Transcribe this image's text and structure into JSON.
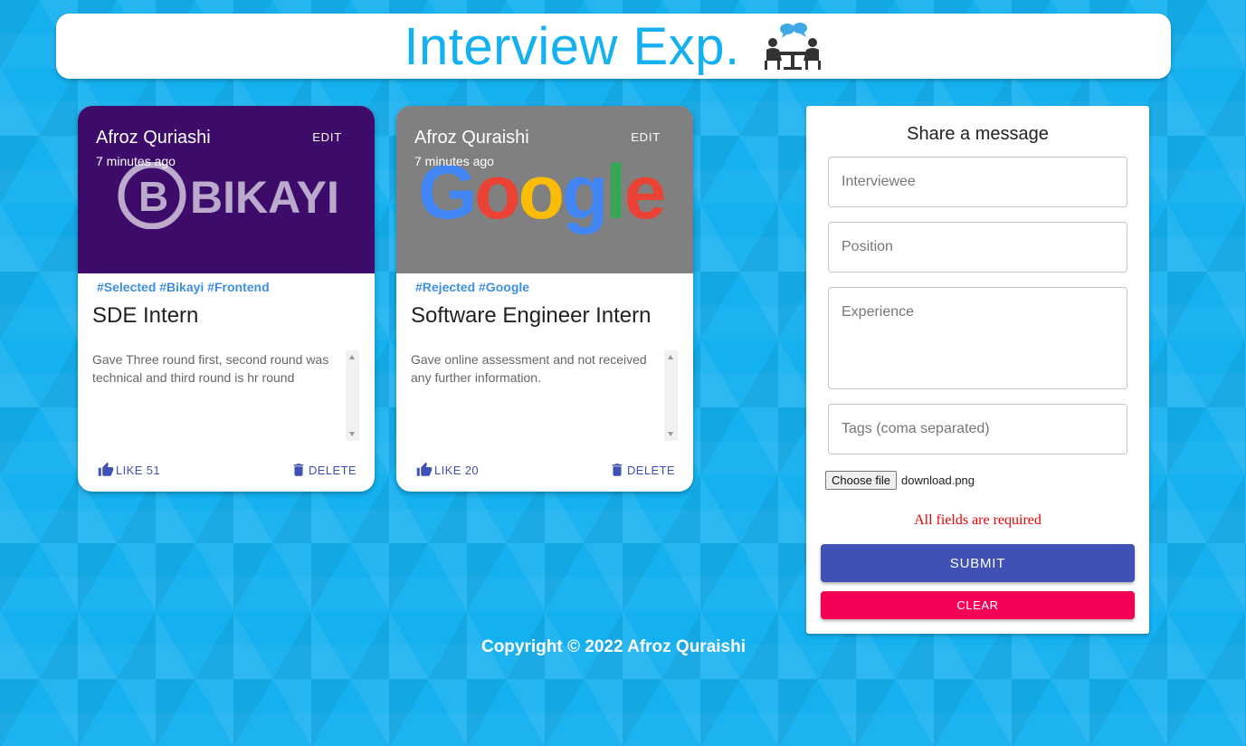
{
  "header": {
    "title": "Interview Exp."
  },
  "posts": [
    {
      "author": "Afroz Quriashi",
      "time": "7 minutes ago",
      "edit_label": "EDIT",
      "media_brand": "BIKAYI",
      "media_color": "#3d0c6b",
      "tags": "#Selected #Bikayi #Frontend",
      "title": "SDE Intern",
      "message": "Gave Three round first, second round was technical and third round is hr round",
      "like_label": "LIKE 51",
      "delete_label": "DELETE"
    },
    {
      "author": "Afroz Quraishi",
      "time": "7 minutes ago",
      "edit_label": "EDIT",
      "media_brand": "Google",
      "media_color": "#808080",
      "tags": "#Rejected #Google",
      "title": "Software Engineer Intern",
      "message": "Gave online assessment and not received any further information.",
      "like_label": "LIKE 20",
      "delete_label": "DELETE"
    }
  ],
  "form": {
    "heading": "Share a message",
    "interviewee_placeholder": "Interviewee",
    "position_placeholder": "Position",
    "experience_placeholder": "Experience",
    "tags_placeholder": "Tags (coma separated)",
    "file_button": "Choose file",
    "file_name": "download.png",
    "error": "All fields are required",
    "submit_label": "SUBMIT",
    "clear_label": "CLEAR"
  },
  "footer": {
    "text": "Copyright © 2022 Afroz Quraishi"
  },
  "colors": {
    "accent": "#14b0f0",
    "primary": "#3f51b5",
    "secondary": "#f50057",
    "tag": "#3f8fe0"
  }
}
